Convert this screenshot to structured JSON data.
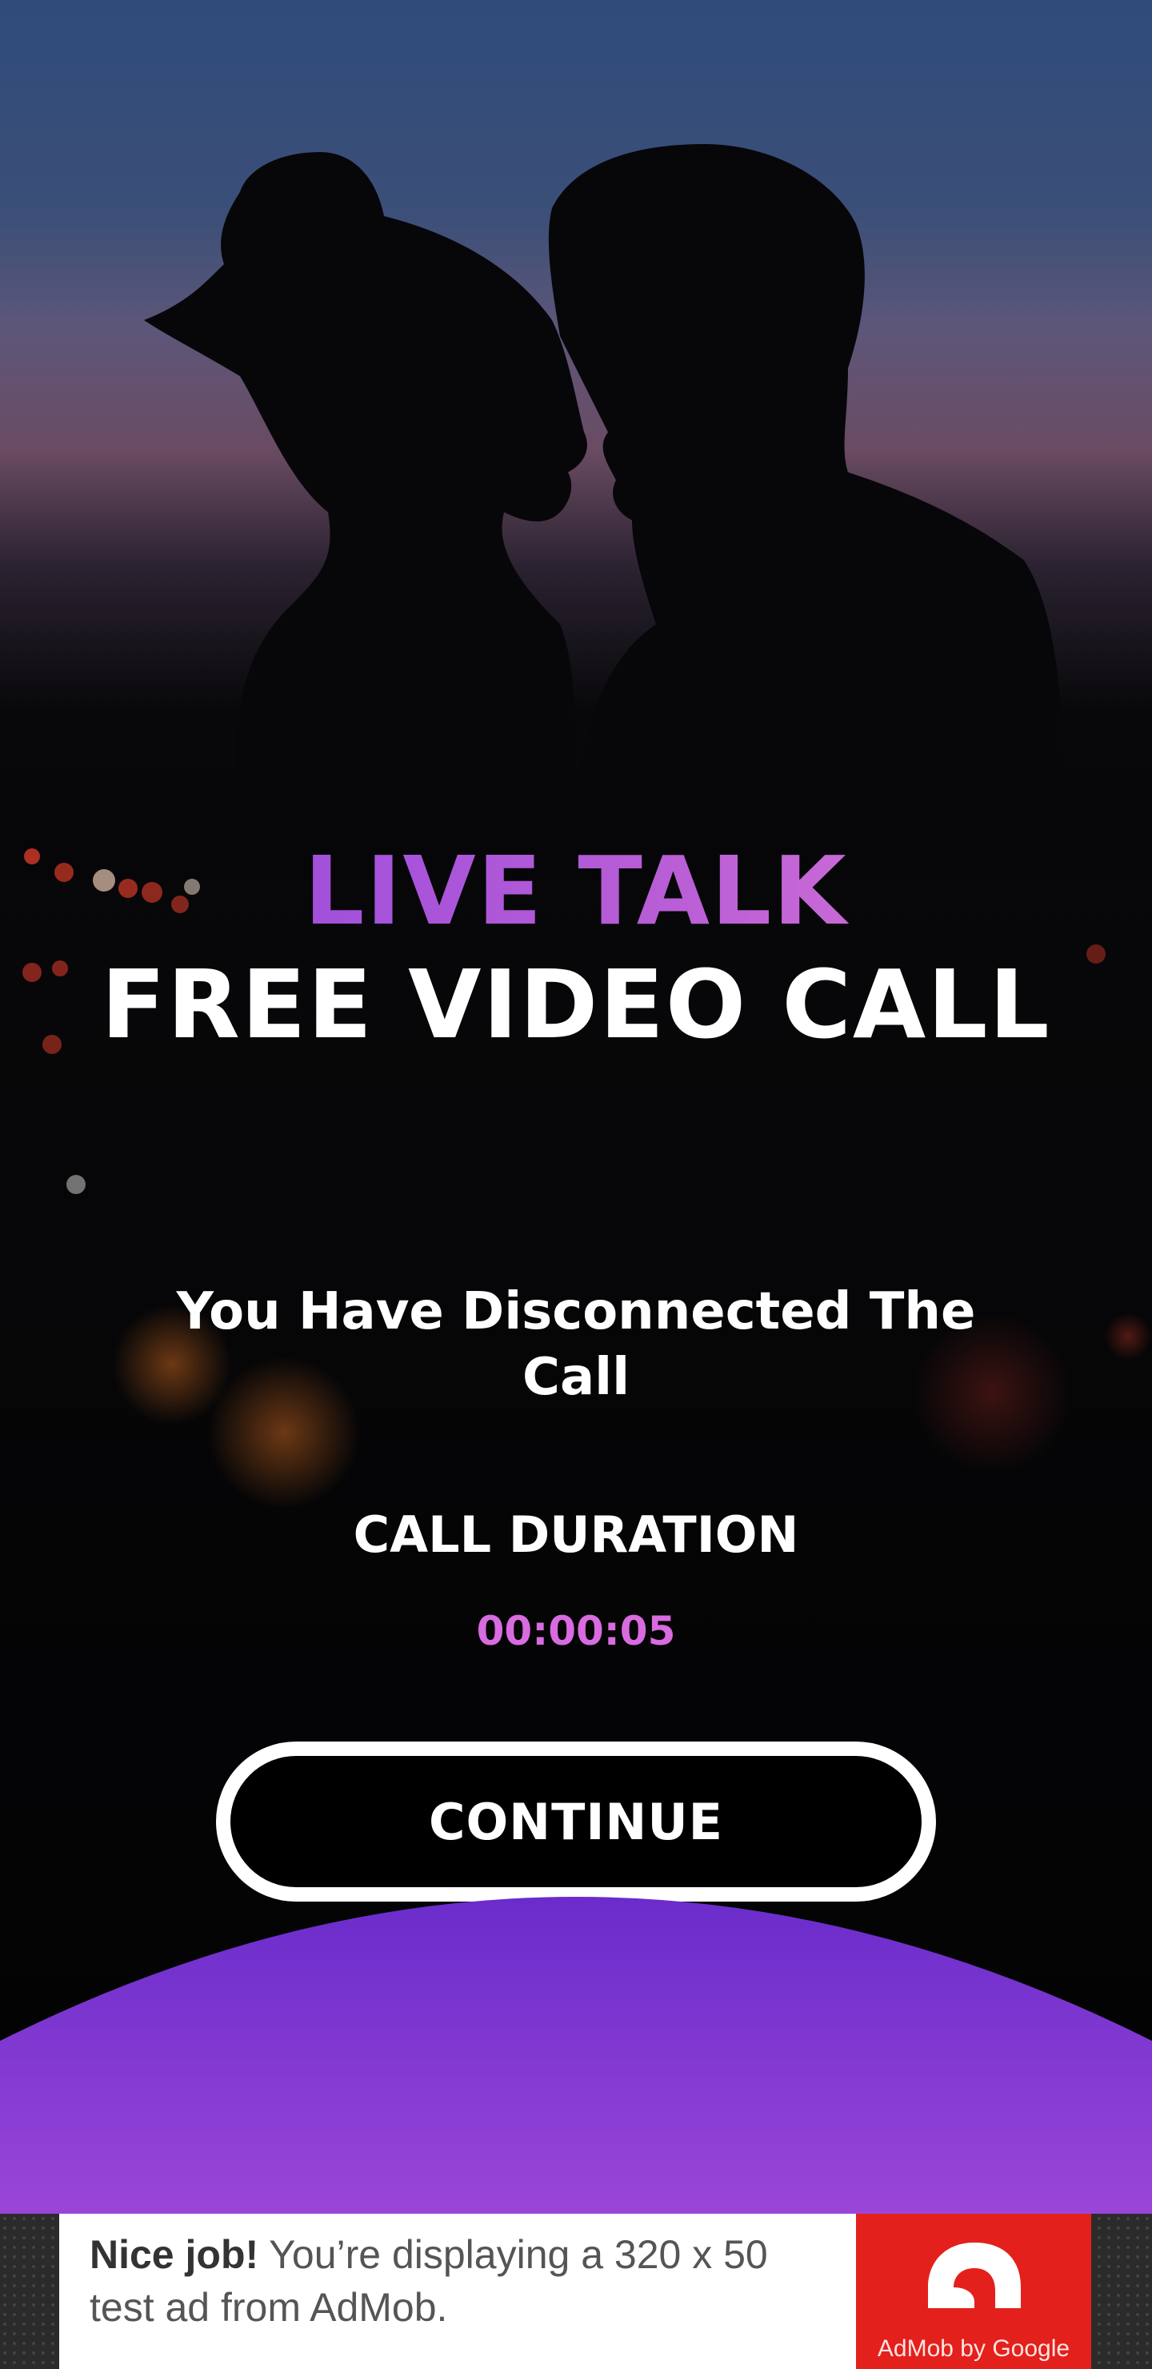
{
  "app": {
    "title_line1": "LIVE TALK",
    "title_line2": "FREE VIDEO CALL",
    "accent_gradient": [
      "#8f45e0",
      "#e07ad6"
    ],
    "arc_gradient": [
      "#6a2ccb",
      "#9a46d8"
    ]
  },
  "call_end": {
    "message": "You Have Disconnected The Call",
    "duration_label": "CALL DURATION",
    "duration_value": "00:00:05",
    "duration_color": "#d96be0"
  },
  "actions": {
    "continue_label": "CONTINUE"
  },
  "ad": {
    "bold_text": "Nice job!",
    "text": " You’re displaying a 320 x 50 test ad from AdMob.",
    "logo_caption": "AdMob by Google",
    "logo_icon": "admob-logo-icon",
    "logo_color": "#e3201b"
  }
}
